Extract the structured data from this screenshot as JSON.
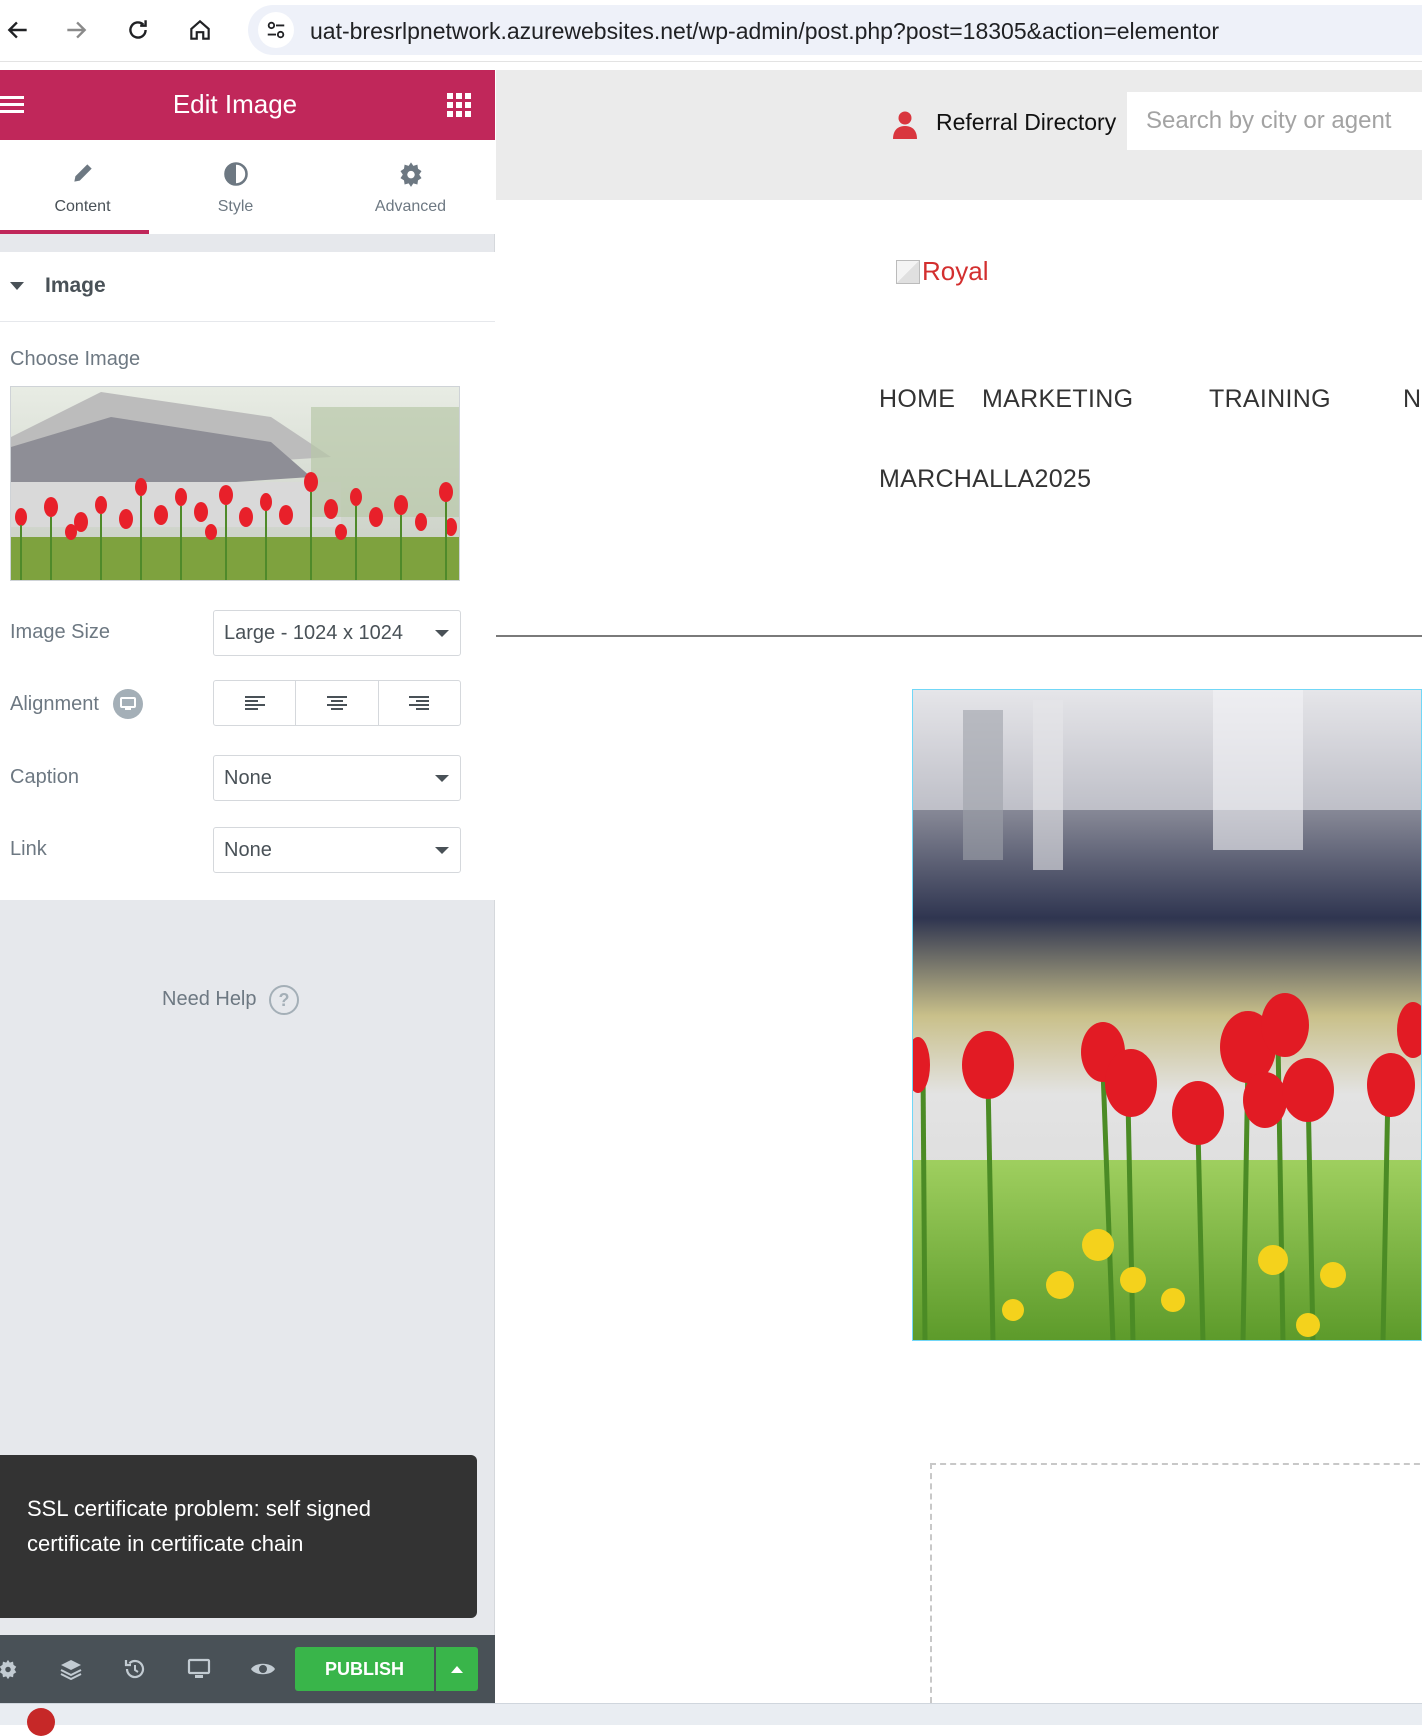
{
  "browser": {
    "url": "uat-bresrlpnetwork.azurewebsites.net/wp-admin/post.php?post=18305&action=elementor"
  },
  "panel": {
    "title": "Edit Image",
    "tabs": [
      {
        "label": "Content"
      },
      {
        "label": "Style"
      },
      {
        "label": "Advanced"
      }
    ],
    "section_title": "Image",
    "choose_image_label": "Choose Image",
    "image_size_label": "Image Size",
    "image_size_value": "Large - 1024 x 1024",
    "alignment_label": "Alignment",
    "caption_label": "Caption",
    "caption_value": "None",
    "link_label": "Link",
    "link_value": "None",
    "need_help": "Need Help",
    "help_icon": "?",
    "toast": "SSL certificate problem: self signed certificate in certificate chain",
    "publish": "PUBLISH"
  },
  "preview": {
    "referral_link": "Referral Directory",
    "search_placeholder": "Search by city or agent",
    "logo_alt": "Royal",
    "nav": [
      "HOME",
      "MARKETING",
      "TRAINING",
      "N",
      "MARCHALLA2025"
    ]
  },
  "colors": {
    "accent": "#c0275a",
    "publish": "#39b54a",
    "toast_bg": "#333333",
    "selection": "#71d7f7"
  },
  "icons": [
    "back-arrow-icon",
    "forward-arrow-icon",
    "reload-icon",
    "home-icon",
    "site-info-icon",
    "hamburger-icon",
    "apps-grid-icon",
    "pencil-icon",
    "half-circle-icon",
    "gear-icon",
    "caret-down-icon",
    "monitor-icon",
    "layers-icon",
    "history-icon",
    "eye-icon",
    "user-icon",
    "chevron-left-icon",
    "chevron-up-icon"
  ]
}
